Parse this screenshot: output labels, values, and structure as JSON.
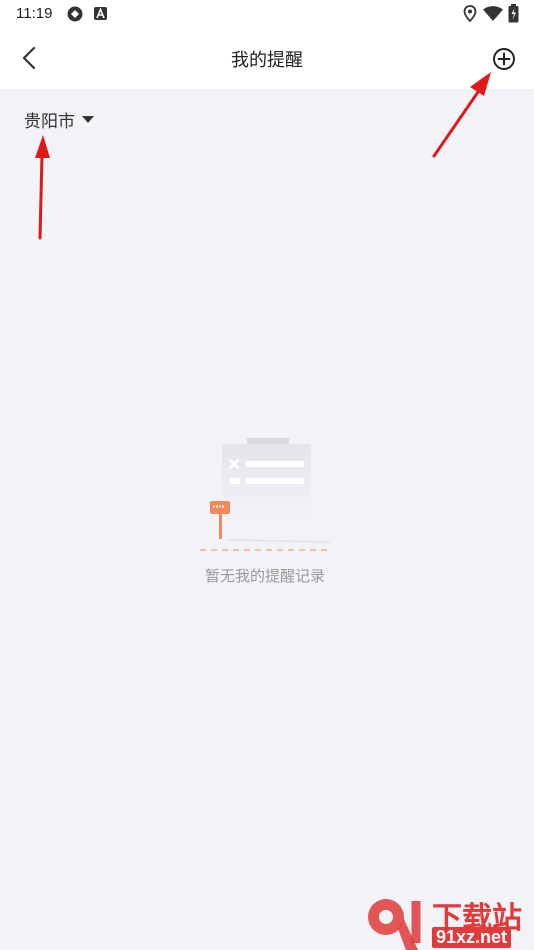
{
  "status_bar": {
    "time": "11:19",
    "left_icons": [
      "sync-icon",
      "a-badge-icon"
    ],
    "right_icons": [
      "location-icon",
      "wifi-icon",
      "battery-icon"
    ]
  },
  "nav": {
    "title": "我的提醒",
    "back_icon": "chevron-left-icon",
    "add_icon": "plus-circle-icon"
  },
  "city_selector": {
    "value": "贵阳市",
    "icon": "caret-down-icon"
  },
  "empty_state": {
    "message": "暂无我的提醒记录"
  },
  "watermark": {
    "logo_text": "9",
    "title": "下载站",
    "domain": "91xz.net"
  },
  "colors": {
    "background": "#f2f3f7",
    "header": "#ffffff",
    "annotation_arrow": "#e01818",
    "empty_accent": "#f08a5d"
  }
}
